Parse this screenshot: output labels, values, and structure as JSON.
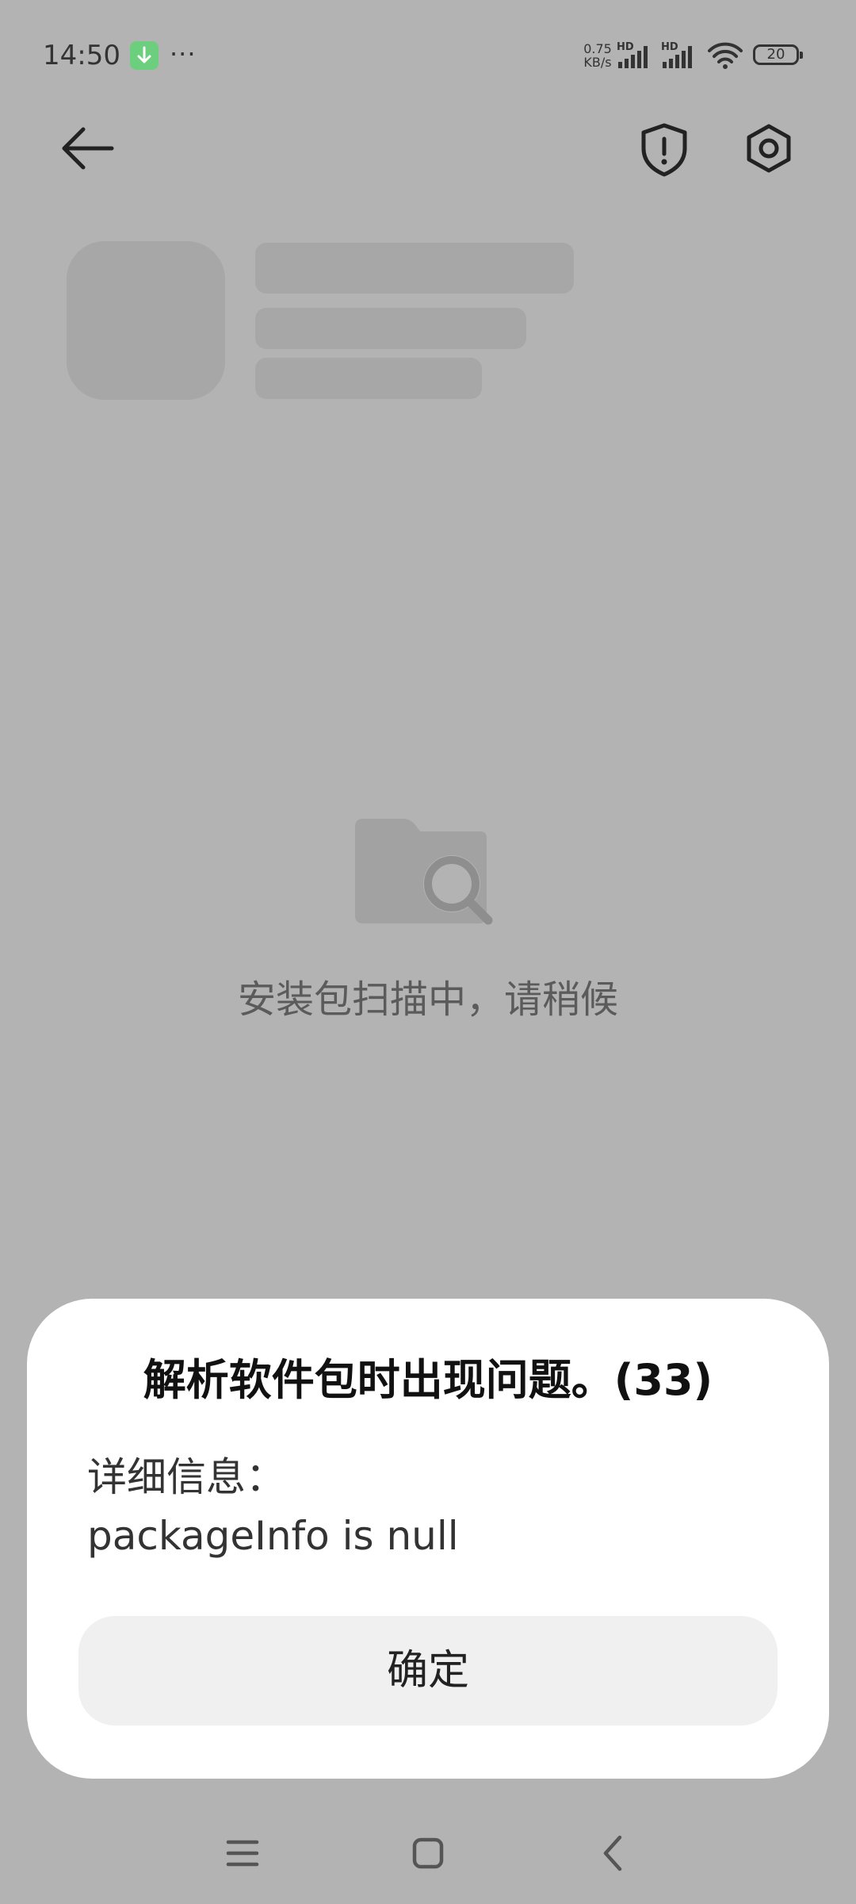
{
  "status_bar": {
    "time": "14:50",
    "more": "···",
    "net_speed_value": "0.75",
    "net_speed_unit": "KB/s",
    "signal_1_label": "HD",
    "signal_2_label": "HD",
    "battery": "20",
    "icons": [
      "download-icon",
      "signal-icon",
      "wifi-icon",
      "battery-icon"
    ]
  },
  "header": {
    "icons": [
      "back-arrow-icon",
      "security-shield-icon",
      "settings-hexagon-icon"
    ]
  },
  "empty_state": {
    "icon": "folder-search-icon",
    "message": "安装包扫描中，请稍候"
  },
  "dialog": {
    "title": "解析软件包时出现问题。(33)",
    "detail_label": "详细信息：",
    "detail_value": "packageInfo is null",
    "ok_label": "确定"
  },
  "nav_bar": {
    "icons": [
      "recents-icon",
      "home-icon",
      "back-icon"
    ]
  },
  "colors": {
    "scrim": "#b3b3b3",
    "skeleton": "#a7a7a7",
    "dialog_background": "#ffffff",
    "button_background": "#f0f0f0",
    "download_badge": "#6ccf7d"
  }
}
